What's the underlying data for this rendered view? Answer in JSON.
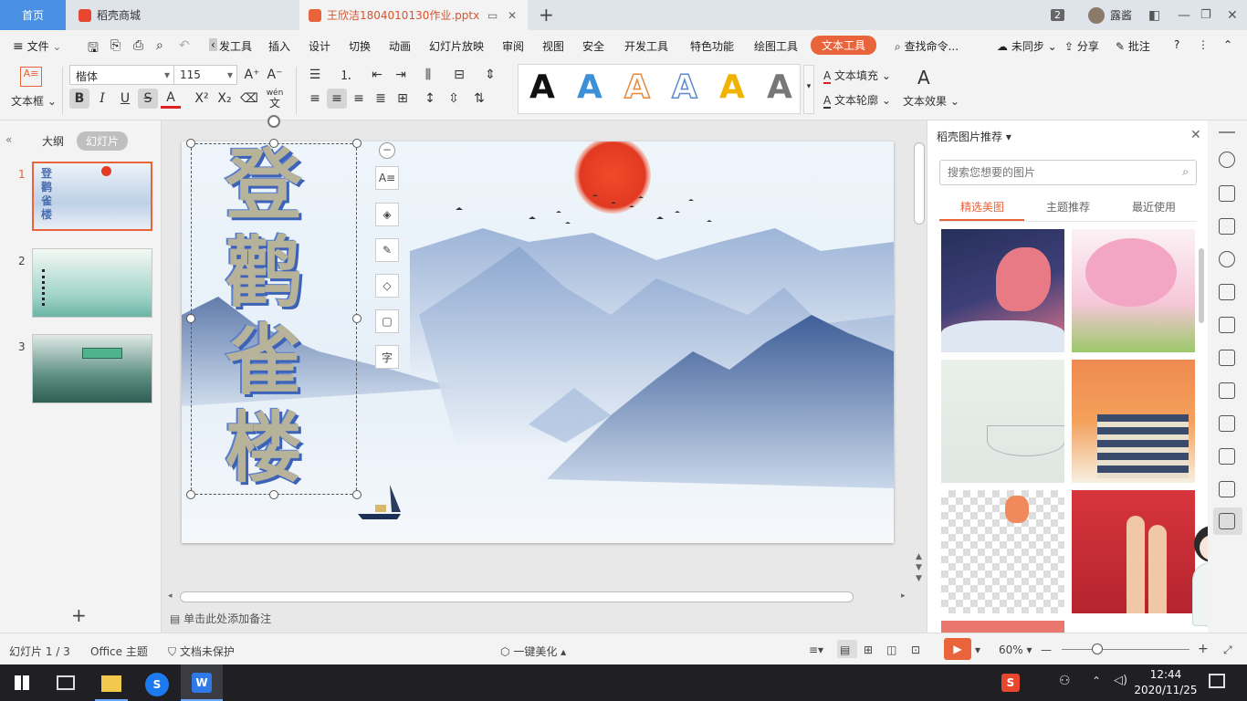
{
  "tabs": {
    "home": "首页",
    "store": "稻壳商城",
    "doc": "王欣洁1804010130作业.pptx",
    "badge": "2",
    "user": "露酱"
  },
  "menu": {
    "file": "文件",
    "items": [
      "发工具",
      "插入",
      "设计",
      "切换",
      "动画",
      "幻灯片放映",
      "审阅",
      "视图",
      "安全",
      "开发工具",
      "特色功能",
      "绘图工具"
    ],
    "active": "文本工具",
    "search": "查找命令...",
    "sync": "未同步",
    "share": "分享",
    "comment": "批注"
  },
  "ribbon": {
    "textbox": "文本框",
    "font_name": "楷体",
    "font_size": "115",
    "pinyin": "wén",
    "text_fill": "文本填充",
    "text_outline": "文本轮廓",
    "text_effect": "文本效果",
    "style_colors": [
      "#111111",
      "#3d8fd6",
      "#e8873a",
      "#5a8ad0",
      "#f0b400",
      "#777777"
    ]
  },
  "leftpane": {
    "outline": "大纲",
    "slides": "幻灯片",
    "nums": [
      "1",
      "2",
      "3"
    ]
  },
  "slide": {
    "title_chars": [
      "登",
      "鹳",
      "雀",
      "楼"
    ]
  },
  "notes": "单击此处添加备注",
  "rightpane": {
    "title": "稻壳图片推荐",
    "search_placeholder": "搜索您想要的图片",
    "tabs": [
      "精选美图",
      "主题推荐",
      "最近使用"
    ]
  },
  "status": {
    "slide": "幻灯片 1 / 3",
    "theme": "Office 主题",
    "protect": "文档未保护",
    "beautify": "一键美化",
    "zoom": "60%"
  },
  "taskbar": {
    "time": "12:44",
    "date": "2020/11/25"
  }
}
